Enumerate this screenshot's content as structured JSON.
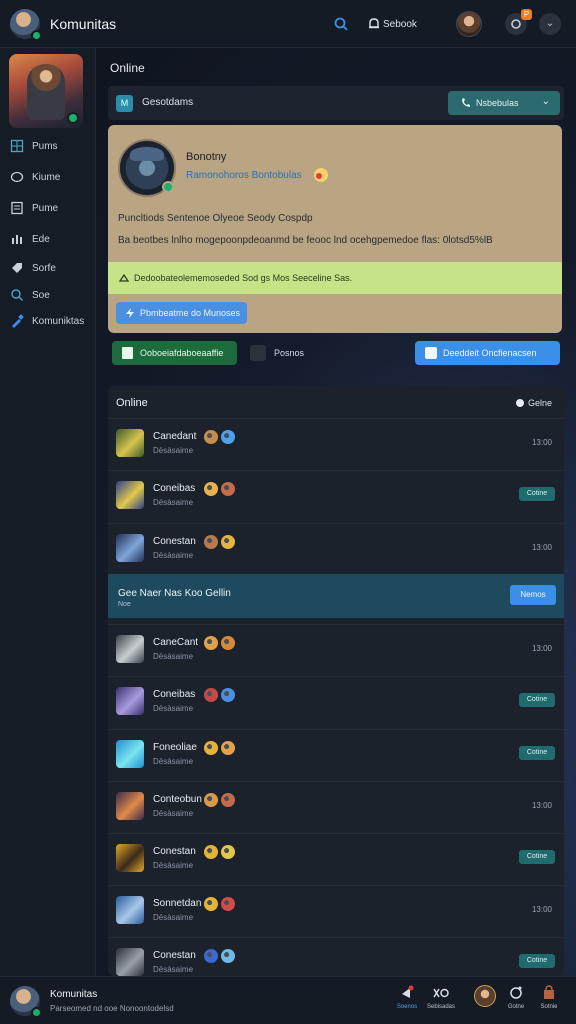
{
  "topbar": {
    "app_title": "Komunitas",
    "notif_label": "Sebook",
    "bell_badge": "P",
    "chevron": "⌄"
  },
  "sidebar": {
    "items": [
      {
        "label": "Pums",
        "icon": "grid-icon"
      },
      {
        "label": "Kiume",
        "icon": "chat-icon"
      },
      {
        "label": "Pume",
        "icon": "doc-icon"
      },
      {
        "label": "Ede",
        "icon": "chart-icon"
      },
      {
        "label": "Sorfe",
        "icon": "tag-icon"
      },
      {
        "label": "Soe",
        "icon": "search-icon"
      },
      {
        "label": "Komuniktas",
        "icon": "brush-icon"
      }
    ]
  },
  "main": {
    "section_title": "Online",
    "group_bar": {
      "icon_text": "M",
      "label": "Gesotdams",
      "select_label": "Nsbebulas",
      "select_caret": "⌄"
    },
    "profile": {
      "name": "Bonotny",
      "subtitle": "Ramonohoros Bontobulas",
      "line1": "Puncltiods Sentenoe Olyeoe Seody Cospdp",
      "line2": "Ba beotbes lnlho mogepoonpdeoanmd be feooc lnd ocehgpemedoe flas: 0lotsd5%lB",
      "alert": "Dedoobateolememoseded Sod gs Mos Seeceline Sas.",
      "link_button": "Pbmbeatme do Munoses"
    },
    "actions": {
      "green": "Ooboeiafdaboeaaffie",
      "plain": "Posnos",
      "blue": "Deeddeit Oncfienacsen"
    }
  },
  "online_panel": {
    "title": "Online",
    "status": "Gelne",
    "rows": [
      {
        "name": "Canedant",
        "sub": "Dësàsaime",
        "meta": "13:00",
        "pill": "",
        "thumb": [
          "#3b5b2a",
          "#d6c34e"
        ],
        "e1": "#c98d4a",
        "e2": "#4aa3f0"
      },
      {
        "name": "Coneibas",
        "sub": "Dësàsaime",
        "meta": "",
        "pill": "Cotine",
        "thumb": [
          "#2b3f8a",
          "#e2c84a"
        ],
        "e1": "#e8b24a",
        "e2": "#c46b4a"
      },
      {
        "name": "Conestan",
        "sub": "Dësàsaime",
        "meta": "13:00",
        "pill": "",
        "thumb": [
          "#1e2f5a",
          "#7fa6d8"
        ],
        "e1": "#b87a4a",
        "e2": "#e6b33a"
      },
      {
        "name": "CaneCant",
        "sub": "Dësàsaime",
        "meta": "13:00",
        "pill": "",
        "thumb": [
          "#3a4046",
          "#c8cdd2"
        ],
        "e1": "#e2a24a",
        "e2": "#d48a3a"
      },
      {
        "name": "Coneibas",
        "sub": "Dësàsaime",
        "meta": "",
        "pill": "Cotine",
        "thumb": [
          "#3a2f6a",
          "#a89ce0"
        ],
        "e1": "#c44a4a",
        "e2": "#4a8fe0"
      },
      {
        "name": "Foneoliae",
        "sub": "Dësàsaime",
        "meta": "",
        "pill": "Cotine",
        "thumb": [
          "#1f8fd0",
          "#7be3f0"
        ],
        "e1": "#e6b33a",
        "e2": "#e2a24a"
      },
      {
        "name": "Conteobun",
        "sub": "Dësàsaime",
        "meta": "13:00",
        "pill": "",
        "thumb": [
          "#3a2a4a",
          "#e08a4a"
        ],
        "e1": "#d89a4a",
        "e2": "#c46b4a"
      },
      {
        "name": "Conestan",
        "sub": "Dësàsaime",
        "meta": "",
        "pill": "Cotine",
        "thumb": [
          "#e6a82a",
          "#3a2a1a"
        ],
        "e1": "#e6b33a",
        "e2": "#e2c84a"
      },
      {
        "name": "Sonnetdan",
        "sub": "Dësàsaime",
        "meta": "13:00",
        "pill": "",
        "thumb": [
          "#2a5a9a",
          "#a8c8e8"
        ],
        "e1": "#e6b33a",
        "e2": "#d44a4a"
      },
      {
        "name": "Conestan",
        "sub": "Dësàsaime",
        "meta": "",
        "pill": "Cotine",
        "thumb": [
          "#2a2f36",
          "#9aa0a8"
        ],
        "e1": "#3a6ad0",
        "e2": "#6fb8e8"
      }
    ],
    "highlight": {
      "title": "Gee Naer Nas Koo Gellin",
      "sub": "Noe",
      "button": "Nemos"
    }
  },
  "bottombar": {
    "name": "Komunitas",
    "subtitle": "Parseomed nd ooe Nonoontodelsd",
    "items": [
      {
        "label": "Soenos",
        "icon": "megaphone-icon",
        "color": "#4aa3f0"
      },
      {
        "label": "Sebisadas",
        "icon": "xo-icon",
        "color": "#b6c0cc"
      },
      {
        "label": "",
        "icon": "avatar-icon",
        "color": "#b6c0cc"
      },
      {
        "label": "Gotne",
        "icon": "refresh-icon",
        "color": "#b6c0cc"
      },
      {
        "label": "Sotnie",
        "icon": "bag-icon",
        "color": "#b6c0cc"
      }
    ]
  },
  "colors": {
    "accent_blue": "#3b8fe7",
    "online_green": "#1fae6b",
    "teal": "#2b6a6e",
    "card_tan": "#b9a483",
    "alert_lime": "#c6e487"
  }
}
